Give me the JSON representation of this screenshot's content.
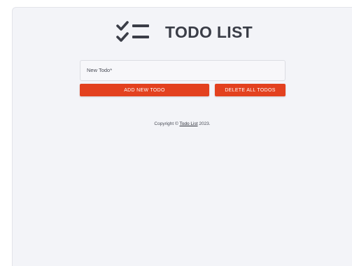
{
  "header": {
    "title": "TODO LIST",
    "logo_icon": "checklist-icon"
  },
  "form": {
    "input_label": "New Todo",
    "required_mark": "*",
    "input_value": ""
  },
  "buttons": {
    "add_label": "ADD NEW TODO",
    "delete_label": "DELETE ALL TODOS"
  },
  "footer": {
    "prefix": "Copyright © ",
    "link_text": "Todo List",
    "suffix": " 2023."
  },
  "colors": {
    "accent": "#e3411f",
    "background": "#f3f4f8",
    "title": "#3a3d47"
  }
}
